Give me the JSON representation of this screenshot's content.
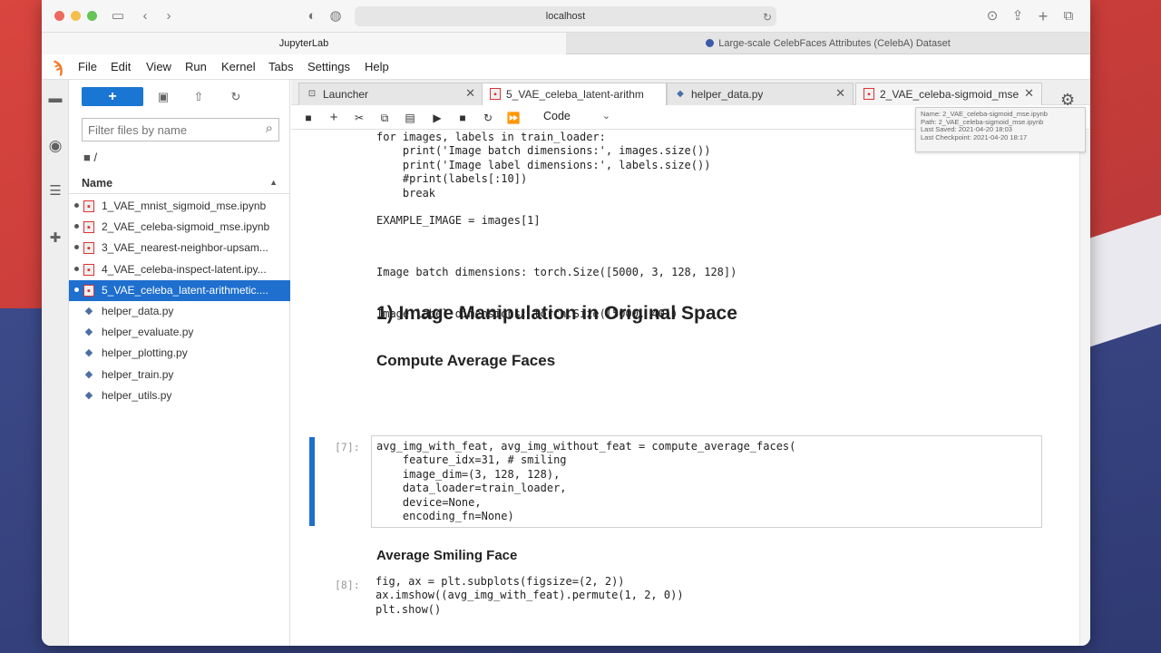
{
  "browser": {
    "address": "localhost",
    "tabs": [
      {
        "label": "JupyterLab",
        "active": true
      },
      {
        "label": "Large-scale CelebFaces Attributes (CelebA) Dataset",
        "active": false
      }
    ]
  },
  "menu": [
    "File",
    "Edit",
    "View",
    "Run",
    "Kernel",
    "Tabs",
    "Settings",
    "Help"
  ],
  "filebrowser": {
    "new_label": "+",
    "filter_placeholder": "Filter files by name",
    "crumb": "/",
    "header": "Name",
    "files": [
      {
        "name": "1_VAE_mnist_sigmoid_mse.ipynb",
        "type": "notebook",
        "running": true,
        "selected": false
      },
      {
        "name": "2_VAE_celeba-sigmoid_mse.ipynb",
        "type": "notebook",
        "running": true,
        "selected": false
      },
      {
        "name": "3_VAE_nearest-neighbor-upsam...",
        "type": "notebook",
        "running": true,
        "selected": false
      },
      {
        "name": "4_VAE_celeba-inspect-latent.ipy...",
        "type": "notebook",
        "running": true,
        "selected": false
      },
      {
        "name": "5_VAE_celeba_latent-arithmetic....",
        "type": "notebook",
        "running": true,
        "selected": true
      },
      {
        "name": "helper_data.py",
        "type": "python",
        "running": false,
        "selected": false
      },
      {
        "name": "helper_evaluate.py",
        "type": "python",
        "running": false,
        "selected": false
      },
      {
        "name": "helper_plotting.py",
        "type": "python",
        "running": false,
        "selected": false
      },
      {
        "name": "helper_train.py",
        "type": "python",
        "running": false,
        "selected": false
      },
      {
        "name": "helper_utils.py",
        "type": "python",
        "running": false,
        "selected": false
      }
    ]
  },
  "doc_tabs": [
    {
      "label": "Launcher",
      "icon": "launcher",
      "active": false
    },
    {
      "label": "5_VAE_celeba_latent-arithm",
      "icon": "notebook",
      "active": true
    },
    {
      "label": "helper_data.py",
      "icon": "python",
      "active": false
    },
    {
      "label": "2_VAE_celeba-sigmoid_mse",
      "icon": "notebook",
      "active": false
    }
  ],
  "notebook_toolbar": {
    "cell_type": "Code"
  },
  "tooltip": {
    "lines": [
      "Name: 2_VAE_celeba-sigmoid_mse.ipynb",
      "Path: 2_VAE_celeba-sigmoid_mse.ipynb",
      "Last Saved: 2021-04-20 18:03",
      "Last Checkpoint: 2021-04-20 18:17"
    ]
  },
  "cells": {
    "top_code": {
      "lines": [
        "for images, labels in train_loader:",
        "    print('Image batch dimensions:', images.size())",
        "    print('Image label dimensions:', labels.size())",
        "    #print(labels[:10])",
        "    break",
        "",
        "EXAMPLE_IMAGE = images[1]"
      ]
    },
    "top_output": [
      "Image batch dimensions: torch.Size([5000, 3, 128, 128])",
      "Image label dimensions: torch.Size([5000, 40])"
    ],
    "heading1": "1) Image Manipulation in Original Space",
    "heading2": "Compute Average Faces",
    "cell7": {
      "prompt": "[7]:",
      "lines": [
        "avg_img_with_feat, avg_img_without_feat = compute_average_faces(",
        "    feature_idx=31, # smiling",
        "    image_dim=(3, 128, 128),",
        "    data_loader=train_loader,",
        "    device=None,",
        "    encoding_fn=None)"
      ]
    },
    "heading3": "Average Smiling Face",
    "cell8": {
      "prompt": "[8]:",
      "lines": [
        "fig, ax = plt.subplots(figsize=(2, 2))",
        "ax.imshow((avg_img_with_feat).permute(1, 2, 0))",
        "plt.show()"
      ]
    }
  }
}
